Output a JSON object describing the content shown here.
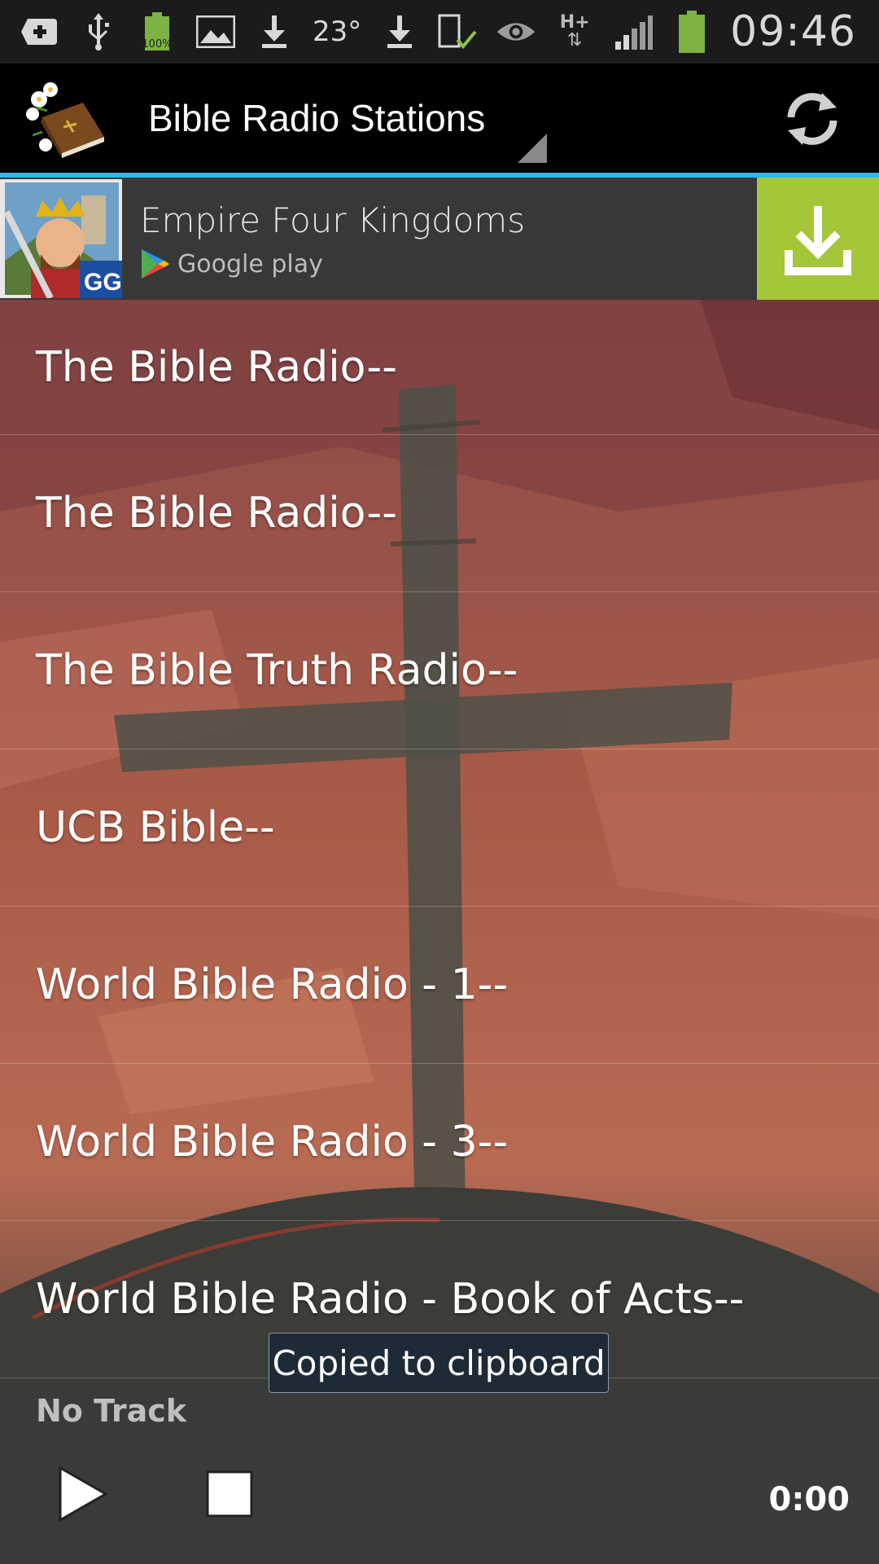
{
  "status_bar": {
    "battery_small_label": "100%",
    "temperature": "23°",
    "time": "09:46",
    "network_label": "H+",
    "icons": [
      "add-icon",
      "usb-icon",
      "battery-icon",
      "gallery-icon",
      "download-icon",
      "download-icon",
      "device-check-icon",
      "eye-icon",
      "network-arrows-icon",
      "signal-icon",
      "battery-icon"
    ]
  },
  "action_bar": {
    "title": "Bible Radio Stations",
    "accent_color": "#33b5e5",
    "icons": [
      "bible-app-icon",
      "refresh-icon"
    ]
  },
  "ad": {
    "title": "Empire Four Kingdoms",
    "store_label": "Google play",
    "action_color": "#a4c639",
    "icons": [
      "game-thumbnail-icon",
      "google-play-icon",
      "download-icon"
    ]
  },
  "stations": [
    "The Bible Radio--",
    "The Bible Radio--",
    "The Bible Truth Radio--",
    "UCB Bible--",
    "World Bible Radio - 1--",
    "World Bible Radio - 3--",
    "World Bible Radio - Book of Acts--"
  ],
  "player": {
    "track": "No Track",
    "elapsed": "0:00",
    "icons": [
      "play-icon",
      "stop-icon"
    ]
  },
  "toast": {
    "message": "Copied to clipboard"
  }
}
